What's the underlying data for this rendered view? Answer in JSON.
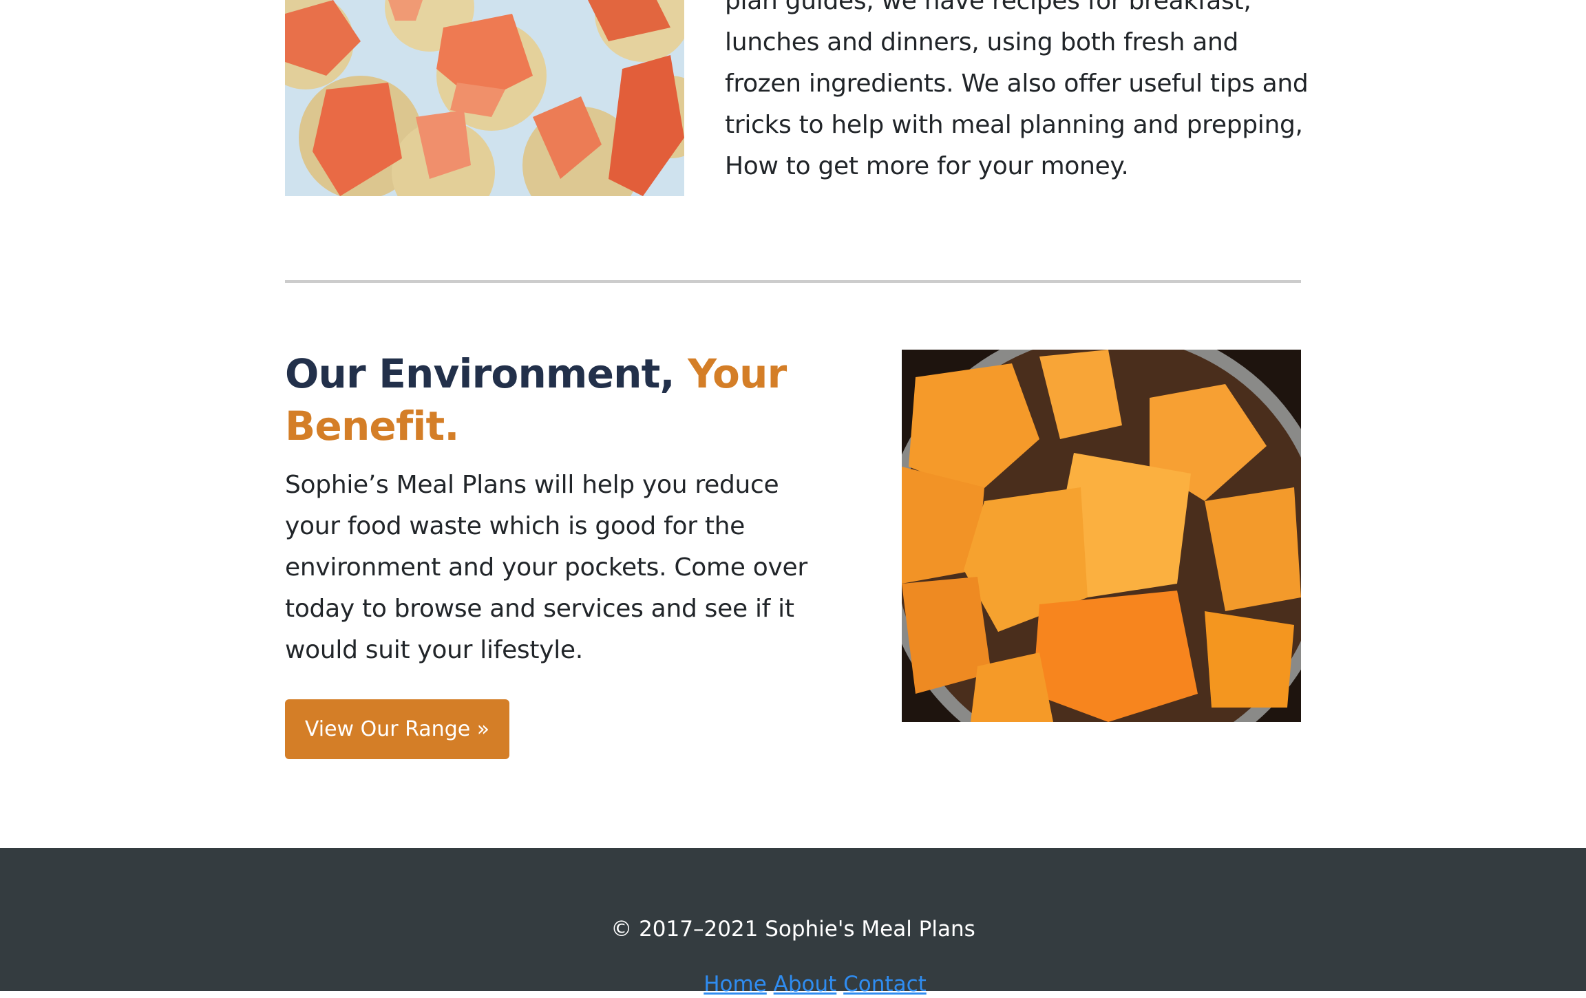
{
  "intro": {
    "paragraph": "plan guides, we have recipes for breakfast, lunches and dinners, using both fresh and frozen ingredients. We also offer useful tips and tricks to help with meal planning and prepping, How to get more for your money."
  },
  "environment": {
    "heading_main": "Our Environment,",
    "heading_accent": "Your Benefit.",
    "paragraph": "Sophie’s Meal Plans will help you reduce your food waste which is good for the environment and your pockets. Come over today to browse and services and see if it would suit your lifestyle.",
    "button_label": "View Our Range »"
  },
  "footer": {
    "copyright": "© 2017–2021 Sophie's Meal Plans",
    "links": [
      "Home",
      "About",
      "Contact"
    ]
  },
  "colors": {
    "accent": "#d47e27",
    "heading": "#22304a",
    "footer_bg": "#343c40",
    "link": "#2f8cf0"
  },
  "images": {
    "top": "smoked-salmon-on-crackers-photo",
    "right": "cooked-squash-in-pot-photo"
  }
}
